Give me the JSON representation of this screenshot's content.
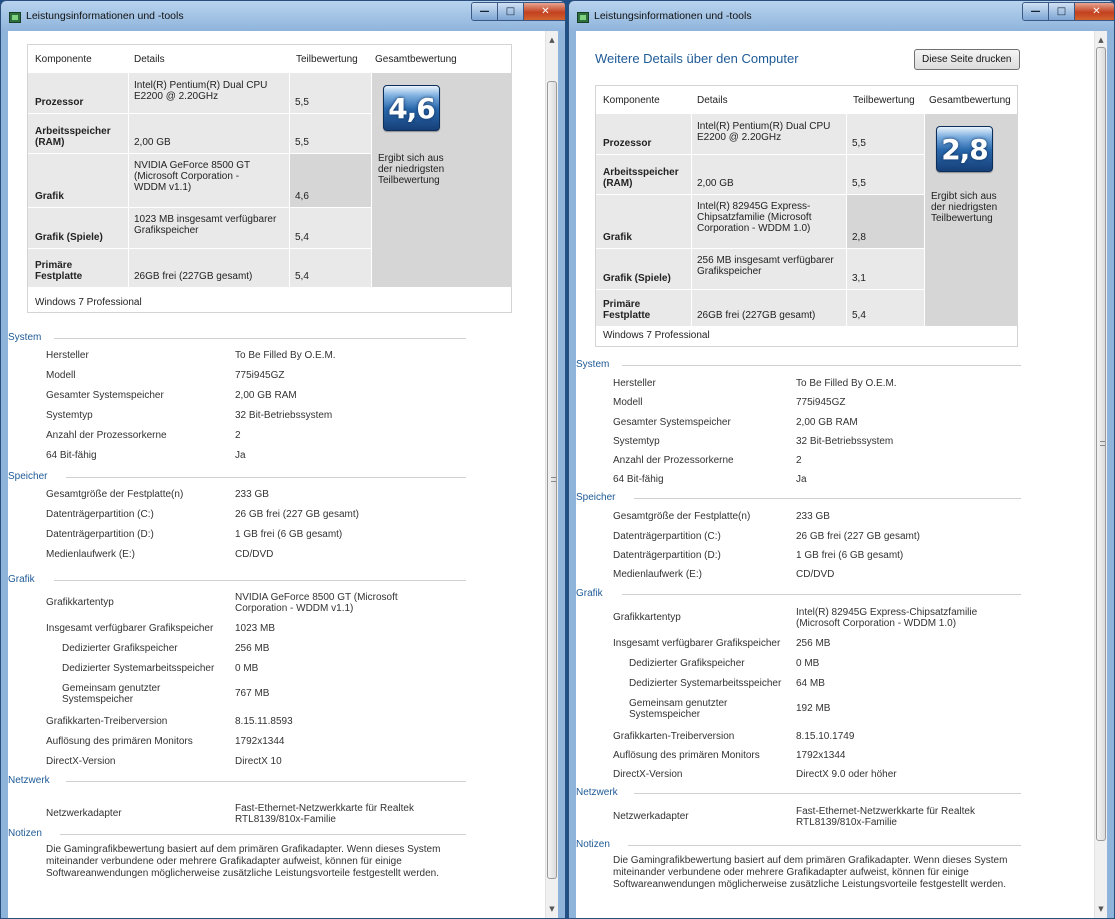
{
  "windows": [
    {
      "title": "Leistungsinformationen und -tools",
      "page_header": "",
      "print_button": "",
      "table_headers": {
        "component": "Komponente",
        "details": "Details",
        "subscore": "Teilbewertung",
        "total": "Gesamtbewertung"
      },
      "components": [
        {
          "name": "Prozessor",
          "details": "Intel(R) Pentium(R) Dual CPU E2200 @ 2.20GHz",
          "score": "5,5"
        },
        {
          "name": "Arbeitsspeicher (RAM)",
          "details": "2,00 GB",
          "score": "5,5"
        },
        {
          "name": "Grafik",
          "details": "NVIDIA GeForce 8500 GT (Microsoft Corporation - WDDM v1.1)",
          "score": "4,6"
        },
        {
          "name": "Grafik (Spiele)",
          "details": "1023 MB insgesamt verfügbarer Grafikspeicher",
          "score": "5,4"
        },
        {
          "name": "Primäre Festplatte",
          "details": "26GB frei (227GB gesamt)",
          "score": "5,4"
        }
      ],
      "base_score": "4,6",
      "base_score_note": "Ergibt sich aus der niedrigsten Teilbewertung",
      "edition": "Windows 7 Professional",
      "sections": [
        {
          "title": "System",
          "rows": [
            {
              "label": "Hersteller",
              "value": "To Be Filled By O.E.M."
            },
            {
              "label": "Modell",
              "value": "775i945GZ"
            },
            {
              "label": "Gesamter Systemspeicher",
              "value": "2,00 GB RAM"
            },
            {
              "label": "Systemtyp",
              "value": "32 Bit-Betriebssystem"
            },
            {
              "label": "Anzahl der Prozessorkerne",
              "value": "2"
            },
            {
              "label": "64 Bit-fähig",
              "value": "Ja"
            }
          ]
        },
        {
          "title": "Speicher",
          "rows": [
            {
              "label": "Gesamtgröße der Festplatte(n)",
              "value": "233 GB"
            },
            {
              "label": "Datenträgerpartition (C:)",
              "value": "26 GB frei (227 GB gesamt)"
            },
            {
              "label": "Datenträgerpartition (D:)",
              "value": "1 GB frei (6 GB gesamt)"
            },
            {
              "label": "Medienlaufwerk (E:)",
              "value": "CD/DVD"
            }
          ]
        },
        {
          "title": "Grafik",
          "rows": [
            {
              "label": "Grafikkartentyp",
              "value": "NVIDIA GeForce 8500 GT (Microsoft Corporation - WDDM v1.1)"
            },
            {
              "label": "Insgesamt verfügbarer Grafikspeicher",
              "value": "1023 MB"
            },
            {
              "label": "Dedizierter Grafikspeicher",
              "value": "256 MB"
            },
            {
              "label": "Dedizierter Systemarbeitsspeicher",
              "value": "0 MB"
            },
            {
              "label": "Gemeinsam genutzter Systemspeicher",
              "value": "767 MB"
            },
            {
              "label": "Grafikkarten-Treiberversion",
              "value": "8.15.11.8593"
            },
            {
              "label": "Auflösung des primären Monitors",
              "value": "1792x1344"
            },
            {
              "label": "DirectX-Version",
              "value": "DirectX 10"
            }
          ]
        },
        {
          "title": "Netzwerk",
          "rows": [
            {
              "label": "Netzwerkadapter",
              "value": "Fast-Ethernet-Netzwerkkarte für Realtek RTL8139/810x-Familie"
            }
          ]
        },
        {
          "title": "Notizen",
          "rows": [
            {
              "label": "",
              "value": "Die Gamingrafikbewertung basiert auf dem primären Grafikadapter. Wenn dieses System miteinander verbundene oder mehrere Grafikadapter aufweist, können für einige Softwareanwendungen möglicherweise zusätzliche Leistungsvorteile festgestellt werden."
            }
          ]
        }
      ]
    },
    {
      "title": "Leistungsinformationen und -tools",
      "page_header": "Weitere Details über den Computer",
      "print_button": "Diese Seite drucken",
      "table_headers": {
        "component": "Komponente",
        "details": "Details",
        "subscore": "Teilbewertung",
        "total": "Gesamtbewertung"
      },
      "components": [
        {
          "name": "Prozessor",
          "details": "Intel(R) Pentium(R) Dual CPU E2200 @ 2.20GHz",
          "score": "5,5"
        },
        {
          "name": "Arbeitsspeicher (RAM)",
          "details": "2,00 GB",
          "score": "5,5"
        },
        {
          "name": "Grafik",
          "details": "Intel(R) 82945G Express-Chipsatzfamilie (Microsoft Corporation - WDDM 1.0)",
          "score": "2,8"
        },
        {
          "name": "Grafik (Spiele)",
          "details": "256 MB insgesamt verfügbarer Grafikspeicher",
          "score": "3,1"
        },
        {
          "name": "Primäre Festplatte",
          "details": "26GB frei (227GB gesamt)",
          "score": "5,4"
        }
      ],
      "base_score": "2,8",
      "base_score_note": "Ergibt sich aus der niedrigsten Teilbewertung",
      "edition": "Windows 7 Professional",
      "sections": [
        {
          "title": "System",
          "rows": [
            {
              "label": "Hersteller",
              "value": "To Be Filled By O.E.M."
            },
            {
              "label": "Modell",
              "value": "775i945GZ"
            },
            {
              "label": "Gesamter Systemspeicher",
              "value": "2,00 GB RAM"
            },
            {
              "label": "Systemtyp",
              "value": "32 Bit-Betriebssystem"
            },
            {
              "label": "Anzahl der Prozessorkerne",
              "value": "2"
            },
            {
              "label": "64 Bit-fähig",
              "value": "Ja"
            }
          ]
        },
        {
          "title": "Speicher",
          "rows": [
            {
              "label": "Gesamtgröße der Festplatte(n)",
              "value": "233 GB"
            },
            {
              "label": "Datenträgerpartition (C:)",
              "value": "26 GB frei (227 GB gesamt)"
            },
            {
              "label": "Datenträgerpartition (D:)",
              "value": "1 GB frei (6 GB gesamt)"
            },
            {
              "label": "Medienlaufwerk (E:)",
              "value": "CD/DVD"
            }
          ]
        },
        {
          "title": "Grafik",
          "rows": [
            {
              "label": "Grafikkartentyp",
              "value": "Intel(R) 82945G Express-Chipsatzfamilie (Microsoft Corporation - WDDM 1.0)"
            },
            {
              "label": "Insgesamt verfügbarer Grafikspeicher",
              "value": "256 MB"
            },
            {
              "label": "Dedizierter Grafikspeicher",
              "value": "0 MB"
            },
            {
              "label": "Dedizierter Systemarbeitsspeicher",
              "value": "64 MB"
            },
            {
              "label": "Gemeinsam genutzter Systemspeicher",
              "value": "192 MB"
            },
            {
              "label": "Grafikkarten-Treiberversion",
              "value": "8.15.10.1749"
            },
            {
              "label": "Auflösung des primären Monitors",
              "value": "1792x1344"
            },
            {
              "label": "DirectX-Version",
              "value": "DirectX 9.0 oder höher"
            }
          ]
        },
        {
          "title": "Netzwerk",
          "rows": [
            {
              "label": "Netzwerkadapter",
              "value": "Fast-Ethernet-Netzwerkkarte für Realtek RTL8139/810x-Familie"
            }
          ]
        },
        {
          "title": "Notizen",
          "rows": [
            {
              "label": "",
              "value": "Die Gamingrafikbewertung basiert auf dem primären Grafikadapter. Wenn dieses System miteinander verbundene oder mehrere Grafikadapter aufweist, können für einige Softwareanwendungen möglicherweise zusätzliche Leistungsvorteile festgestellt werden."
            }
          ]
        }
      ]
    }
  ]
}
